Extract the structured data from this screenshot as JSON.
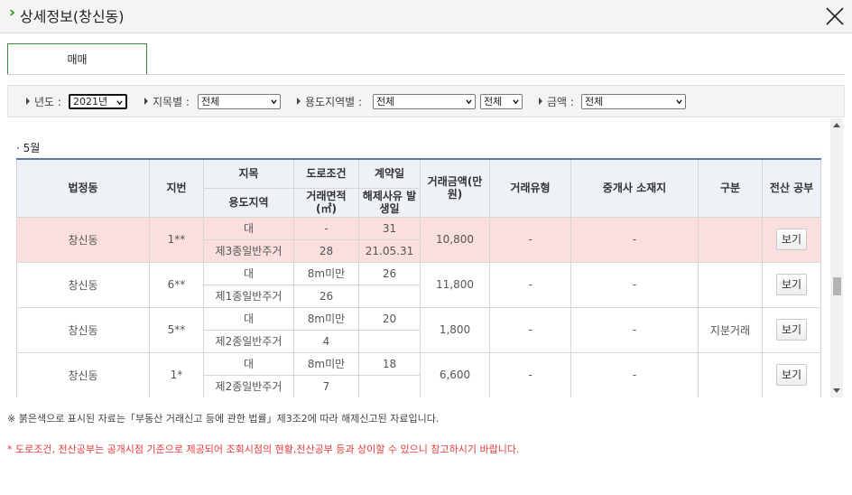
{
  "window": {
    "chevron": "›",
    "title": "상세정보(창신동)",
    "close_icon": "close-icon"
  },
  "tabs": [
    {
      "label": "매매",
      "active": true
    }
  ],
  "filters": {
    "year_label": "년도 :",
    "year_value": "2021년",
    "land_label": "지목별 :",
    "land_value": "전체",
    "zone_label": "용도지역별 :",
    "zone_value": "전체",
    "zone_sub_value": "전체",
    "amount_label": "금액 :",
    "amount_value": "전체"
  },
  "section": {
    "month_label": "· 5월"
  },
  "table": {
    "headers": {
      "dong": "법정동",
      "jibun": "지번",
      "jimok": "지목",
      "road": "도로조건",
      "contract": "계약일",
      "amount": "거래금액(만원)",
      "type": "거래유형",
      "broker": "중개사 소재지",
      "gubun": "구분",
      "register": "전산 공부",
      "zone": "용도지역",
      "area": "거래면적 (㎡)",
      "cancel": "해제사유 발생일"
    },
    "rows": [
      {
        "dong": "창신동",
        "jibun": "1**",
        "jimok": "대",
        "road": "-",
        "contract": "31",
        "zone": "제3종일반주거",
        "area": "28",
        "cancel": "21.05.31",
        "amount": "10,800",
        "type": "-",
        "broker": "-",
        "gubun": "",
        "button": "보기",
        "highlight": true
      },
      {
        "dong": "창신동",
        "jibun": "6**",
        "jimok": "대",
        "road": "8m미만",
        "contract": "26",
        "zone": "제1종일반주거",
        "area": "26",
        "cancel": "",
        "amount": "11,800",
        "type": "-",
        "broker": "-",
        "gubun": "",
        "button": "보기",
        "highlight": false
      },
      {
        "dong": "창신동",
        "jibun": "5**",
        "jimok": "대",
        "road": "8m미만",
        "contract": "20",
        "zone": "제2종일반주거",
        "area": "4",
        "cancel": "",
        "amount": "1,800",
        "type": "-",
        "broker": "-",
        "gubun": "지분거래",
        "button": "보기",
        "highlight": false
      },
      {
        "dong": "창신동",
        "jibun": "1*",
        "jimok": "대",
        "road": "8m미만",
        "contract": "18",
        "zone": "제2종일반주거",
        "area": "7",
        "cancel": "",
        "amount": "6,600",
        "type": "-",
        "broker": "-",
        "gubun": "",
        "button": "보기",
        "highlight": false
      }
    ]
  },
  "notes": {
    "note1": "※ 붉은색으로 표시된 자료는「부동산 거래신고 등에 관한 법률」제3조2에 따라 해제신고된 자료입니다.",
    "note2": "* 도로조건, 전산공부는 공개시점 기준으로 제공되어 조회시점의 현황,전산공부 등과 상이할 수 있으니 참고하시기 바랍니다."
  },
  "colors": {
    "accent_green": "#3b8d1f",
    "highlight_row": "#fbdede",
    "header_bg": "#eef1f5",
    "warning_red": "#e53a3a"
  }
}
